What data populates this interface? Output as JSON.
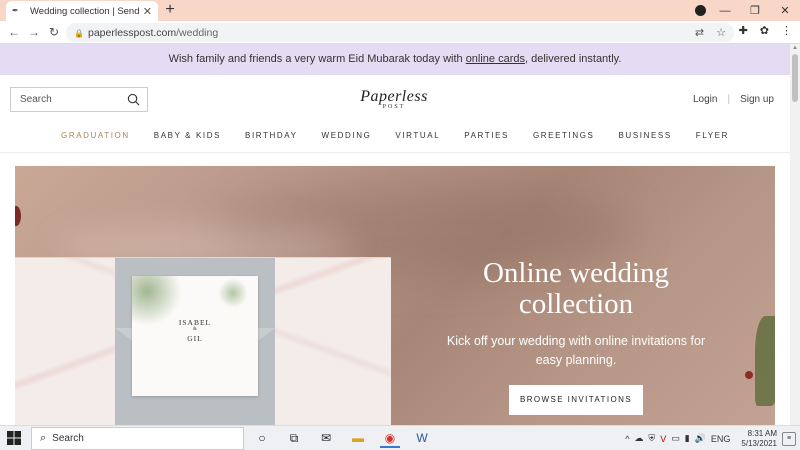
{
  "browser": {
    "tab_title": "Wedding collection | Send online",
    "tab_close": "✕",
    "new_tab": "+",
    "url_domain": "paperlesspost.com",
    "url_path": "/wedding",
    "window_controls": [
      "—",
      "❐",
      "✕"
    ]
  },
  "banner": {
    "text_before": "Wish family and friends a very warm Eid Mubarak today with ",
    "link": "online cards",
    "text_after": ", delivered instantly."
  },
  "header": {
    "search_placeholder": "Search",
    "logo_main": "Paperless",
    "logo_sub": "POST",
    "login": "Login",
    "separator": "|",
    "signup": "Sign up"
  },
  "nav": {
    "items": [
      {
        "label": "GRADUATION",
        "active": true
      },
      {
        "label": "BABY & KIDS",
        "active": false
      },
      {
        "label": "BIRTHDAY",
        "active": false
      },
      {
        "label": "WEDDING",
        "active": false
      },
      {
        "label": "VIRTUAL",
        "active": false
      },
      {
        "label": "PARTIES",
        "active": false
      },
      {
        "label": "GREETINGS",
        "active": false
      },
      {
        "label": "BUSINESS",
        "active": false
      },
      {
        "label": "FLYER",
        "active": false
      }
    ],
    "active_color": "#a8855a"
  },
  "hero": {
    "title_line1": "Online wedding",
    "title_line2": "collection",
    "subtitle_line1": "Kick off your wedding with online invitations for",
    "subtitle_line2": "easy planning.",
    "button": "BROWSE INVITATIONS",
    "invite": {
      "name1": "ISABEL",
      "amp": "&",
      "name2": "GIL"
    }
  },
  "taskbar": {
    "search_label": "Search",
    "language": "ENG",
    "time": "8:31 AM",
    "date": "5/13/2021"
  }
}
